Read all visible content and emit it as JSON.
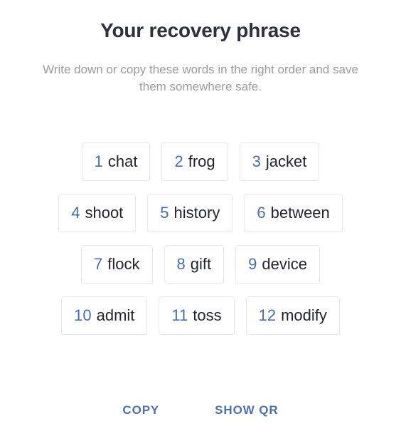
{
  "screen": {
    "title": "Your recovery phrase",
    "subtitle": "Write down or copy these words in the right order and save them somewhere safe.",
    "background_color": "#ffffff"
  },
  "colors": {
    "title": "#2d303d",
    "subtitle": "#9b9b9b",
    "chip_border": "#e6e8ec",
    "chip_index": "#4a6da7",
    "chip_word": "#22242e",
    "action_text": "#5170a8"
  },
  "recovery_phrase": {
    "word_count": 12,
    "rows": [
      [
        {
          "index": "1",
          "word": "chat"
        },
        {
          "index": "2",
          "word": "frog"
        },
        {
          "index": "3",
          "word": "jacket"
        }
      ],
      [
        {
          "index": "4",
          "word": "shoot"
        },
        {
          "index": "5",
          "word": "history"
        },
        {
          "index": "6",
          "word": "between"
        }
      ],
      [
        {
          "index": "7",
          "word": "flock"
        },
        {
          "index": "8",
          "word": "gift"
        },
        {
          "index": "9",
          "word": "device"
        }
      ],
      [
        {
          "index": "10",
          "word": "admit"
        },
        {
          "index": "11",
          "word": "toss"
        },
        {
          "index": "12",
          "word": "modify"
        }
      ]
    ]
  },
  "actions": {
    "copy_label": "COPY",
    "show_qr_label": "SHOW QR"
  }
}
